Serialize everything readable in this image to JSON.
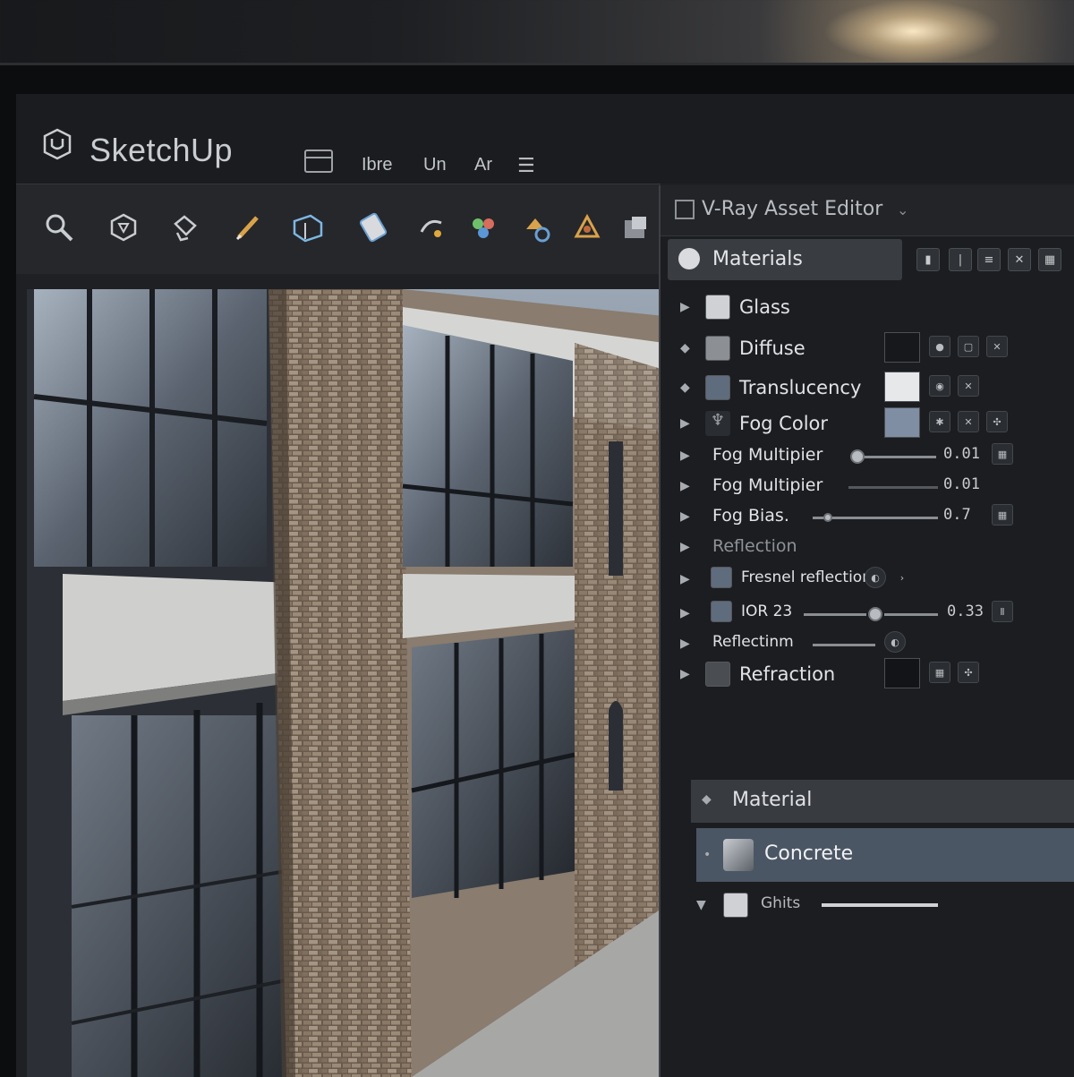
{
  "app": {
    "title": "SketchUp",
    "menu": [
      "Ibre",
      "Un",
      "Ar"
    ]
  },
  "toolbar": {
    "tools": [
      "search-icon",
      "shape-icon",
      "paint-bucket-icon",
      "pencil-icon",
      "push-pull-icon",
      "rotate-icon",
      "move-icon",
      "component-icon",
      "materials-icon",
      "layers-icon",
      "box-icon"
    ]
  },
  "vray": {
    "title": "V-Ray Asset Editor",
    "section": "Materials",
    "rows": [
      {
        "arrow": "▶",
        "label": "Glass",
        "swatch": "#cfd1d4"
      },
      {
        "arrow": "◆",
        "label": "Diffuse",
        "swatch": "#8c8f93",
        "color": "#16181b"
      },
      {
        "arrow": "◆",
        "label": "Translucency",
        "swatch": "#5f6c7d",
        "color": "#e6e8ea"
      },
      {
        "arrow": "▶",
        "label": "Fog Color",
        "color": "#7f8ea3"
      },
      {
        "arrow": "▶",
        "label": "Fog Multipier",
        "value": "0.01"
      },
      {
        "arrow": "▶",
        "label": "Fog Multipier",
        "value": "0.01"
      },
      {
        "arrow": "▶",
        "label": "Fog Bias.",
        "value": "0.7"
      },
      {
        "arrow": "▶",
        "label": "Reflection"
      },
      {
        "arrow": "▶",
        "label": "Fresnel reflection",
        "swatch": "#5f6c7d"
      },
      {
        "arrow": "▶",
        "label": "IOR 23",
        "swatch": "#5f6c7d",
        "value": "0.33"
      },
      {
        "arrow": "▶",
        "label": "Reflectinm"
      },
      {
        "arrow": "▶",
        "label": "Refraction",
        "swatch": "#4a4d52",
        "color": "#121417"
      }
    ],
    "material_header": "Material",
    "selected": "Concrete",
    "sub_item": "Ghits"
  }
}
